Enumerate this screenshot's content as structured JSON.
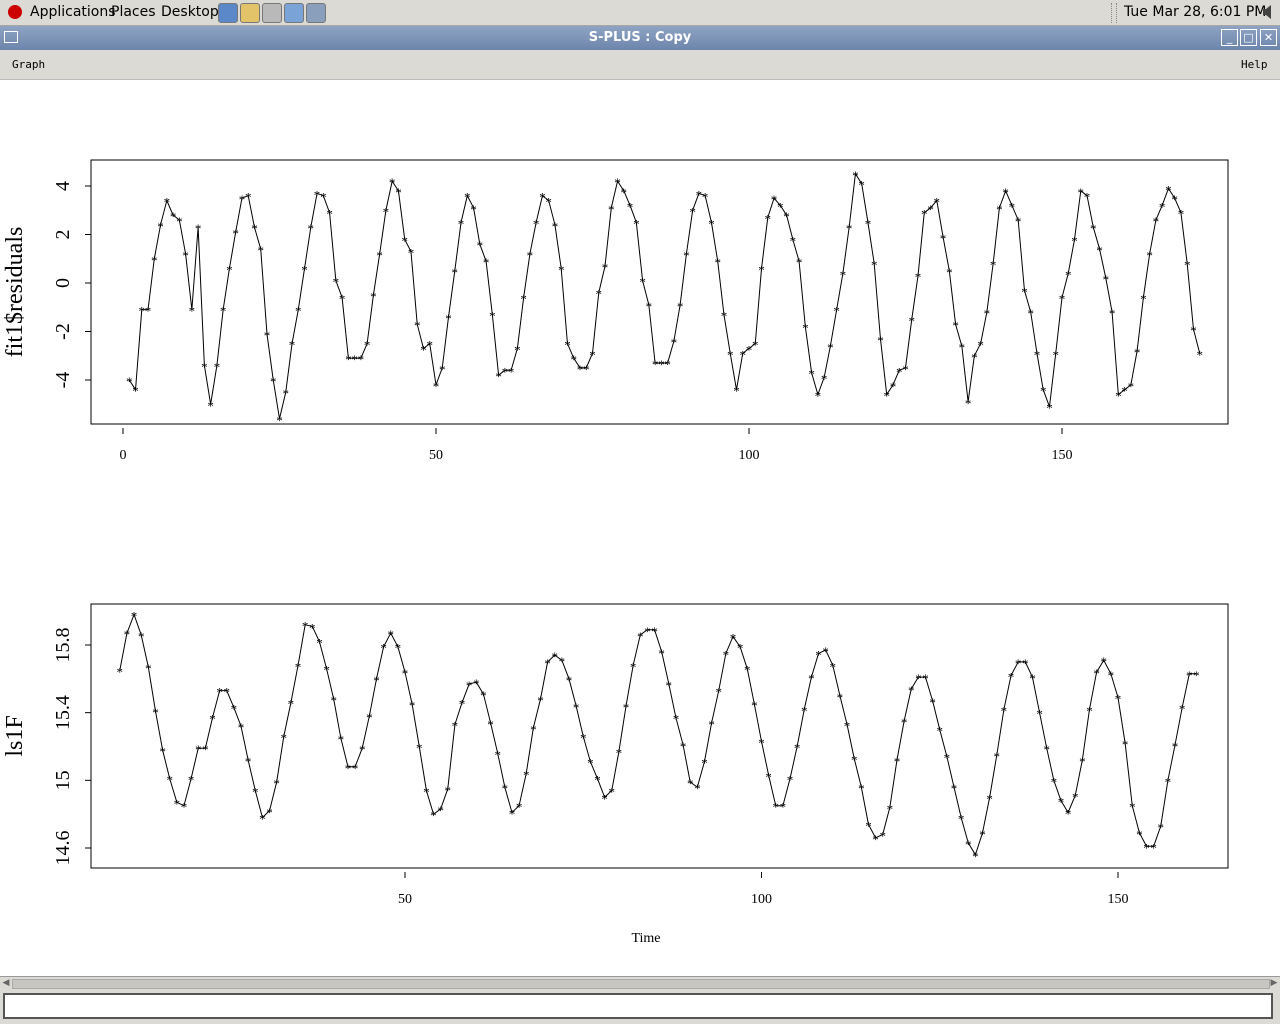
{
  "panel": {
    "menus": [
      "Applications",
      "Places",
      "Desktop"
    ],
    "clock": "Tue Mar 28,  6:01 PM"
  },
  "window": {
    "title": "S-PLUS : Copy",
    "menu_graph": "Graph",
    "menu_help": "Help"
  },
  "chart_data": [
    {
      "type": "line",
      "ylabel": "fit1$residuals",
      "xlabel": "",
      "xlim": [
        0,
        170
      ],
      "ylim": [
        -5.8,
        5.8
      ],
      "xticks": [
        0,
        50,
        100,
        150
      ],
      "yticks": [
        -4,
        -2,
        0,
        2,
        4
      ],
      "marker": "*",
      "x_start": 1,
      "y": [
        -4.0,
        -4.4,
        -1.1,
        -1.1,
        1.0,
        2.4,
        3.4,
        2.8,
        2.6,
        1.2,
        -1.1,
        2.3,
        -3.4,
        -5.0,
        -3.4,
        -1.1,
        0.6,
        2.1,
        3.5,
        3.6,
        2.3,
        1.4,
        -2.1,
        -4.0,
        -5.6,
        -4.5,
        -2.5,
        -1.1,
        0.6,
        2.3,
        3.7,
        3.6,
        2.9,
        0.1,
        -0.6,
        -3.1,
        -3.1,
        -3.1,
        -2.5,
        -0.5,
        1.2,
        3.0,
        4.2,
        3.8,
        1.8,
        1.3,
        -1.7,
        -2.7,
        -2.5,
        -4.2,
        -3.5,
        -1.4,
        0.5,
        2.5,
        3.6,
        3.1,
        1.6,
        0.9,
        -1.3,
        -3.8,
        -3.6,
        -3.6,
        -2.7,
        -0.6,
        1.2,
        2.5,
        3.6,
        3.4,
        2.4,
        0.6,
        -2.5,
        -3.1,
        -3.5,
        -3.5,
        -2.9,
        -0.4,
        0.7,
        3.1,
        4.2,
        3.8,
        3.2,
        2.5,
        0.1,
        -0.9,
        -3.3,
        -3.3,
        -3.3,
        -2.4,
        -0.9,
        1.2,
        3.0,
        3.7,
        3.6,
        2.5,
        0.9,
        -1.3,
        -2.9,
        -4.4,
        -2.9,
        -2.7,
        -2.5,
        0.6,
        2.7,
        3.5,
        3.2,
        2.8,
        1.8,
        0.9,
        -1.8,
        -3.7,
        -4.6,
        -3.9,
        -2.6,
        -1.1,
        0.4,
        2.3,
        4.5,
        4.1,
        2.5,
        0.8,
        -2.3,
        -4.6,
        -4.2,
        -3.6,
        -3.5,
        -1.5,
        0.3,
        2.9,
        3.1,
        3.4,
        1.9,
        0.5,
        -1.7,
        -2.6,
        -4.9,
        -3.0,
        -2.5,
        -1.2,
        0.8,
        3.1,
        3.8,
        3.2,
        2.6,
        -0.3,
        -1.2,
        -2.9,
        -4.4,
        -5.1,
        -2.9,
        -0.6,
        0.4,
        1.8,
        3.8,
        3.6,
        2.3,
        1.4,
        0.2,
        -1.2,
        -4.6,
        -4.4,
        -4.2,
        -2.8,
        -0.6,
        1.2,
        2.6,
        3.2,
        3.9,
        3.5,
        2.9,
        0.8,
        -1.9,
        -2.9
      ]
    },
    {
      "type": "line",
      "ylabel": "ls1F",
      "xlabel": "Time",
      "xlim": [
        8,
        166
      ],
      "ylim": [
        14.5,
        16.1
      ],
      "xticks": [
        50,
        100,
        150
      ],
      "yticks": [
        14.6,
        15.0,
        15.4,
        15.8
      ],
      "marker": "*",
      "x_start": 10,
      "y": [
        15.65,
        15.87,
        15.98,
        15.86,
        15.67,
        15.41,
        15.18,
        15.01,
        14.87,
        14.85,
        15.01,
        15.19,
        15.19,
        15.37,
        15.53,
        15.53,
        15.43,
        15.32,
        15.12,
        14.94,
        14.78,
        14.82,
        14.99,
        15.26,
        15.46,
        15.68,
        15.92,
        15.91,
        15.82,
        15.66,
        15.48,
        15.25,
        15.08,
        15.08,
        15.19,
        15.38,
        15.6,
        15.79,
        15.87,
        15.79,
        15.64,
        15.45,
        15.2,
        14.94,
        14.8,
        14.83,
        14.95,
        15.33,
        15.46,
        15.57,
        15.58,
        15.51,
        15.34,
        15.16,
        14.96,
        14.81,
        14.85,
        15.04,
        15.31,
        15.48,
        15.7,
        15.74,
        15.71,
        15.6,
        15.44,
        15.26,
        15.11,
        15.01,
        14.9,
        14.94,
        15.17,
        15.44,
        15.68,
        15.86,
        15.89,
        15.89,
        15.76,
        15.57,
        15.37,
        15.21,
        14.99,
        14.96,
        15.11,
        15.34,
        15.53,
        15.75,
        15.85,
        15.79,
        15.66,
        15.45,
        15.23,
        15.03,
        14.85,
        14.85,
        15.01,
        15.2,
        15.42,
        15.61,
        15.75,
        15.77,
        15.68,
        15.5,
        15.33,
        15.13,
        14.96,
        14.74,
        14.66,
        14.68,
        14.84,
        15.12,
        15.35,
        15.54,
        15.61,
        15.61,
        15.47,
        15.3,
        15.14,
        14.96,
        14.78,
        14.63,
        14.56,
        14.69,
        14.9,
        15.15,
        15.42,
        15.62,
        15.7,
        15.7,
        15.61,
        15.4,
        15.19,
        15.0,
        14.88,
        14.81,
        14.91,
        15.12,
        15.42,
        15.64,
        15.71,
        15.63,
        15.49,
        15.22,
        14.85,
        14.69,
        14.61,
        14.61,
        14.73,
        15.0,
        15.21,
        15.43,
        15.63,
        15.63
      ]
    }
  ]
}
